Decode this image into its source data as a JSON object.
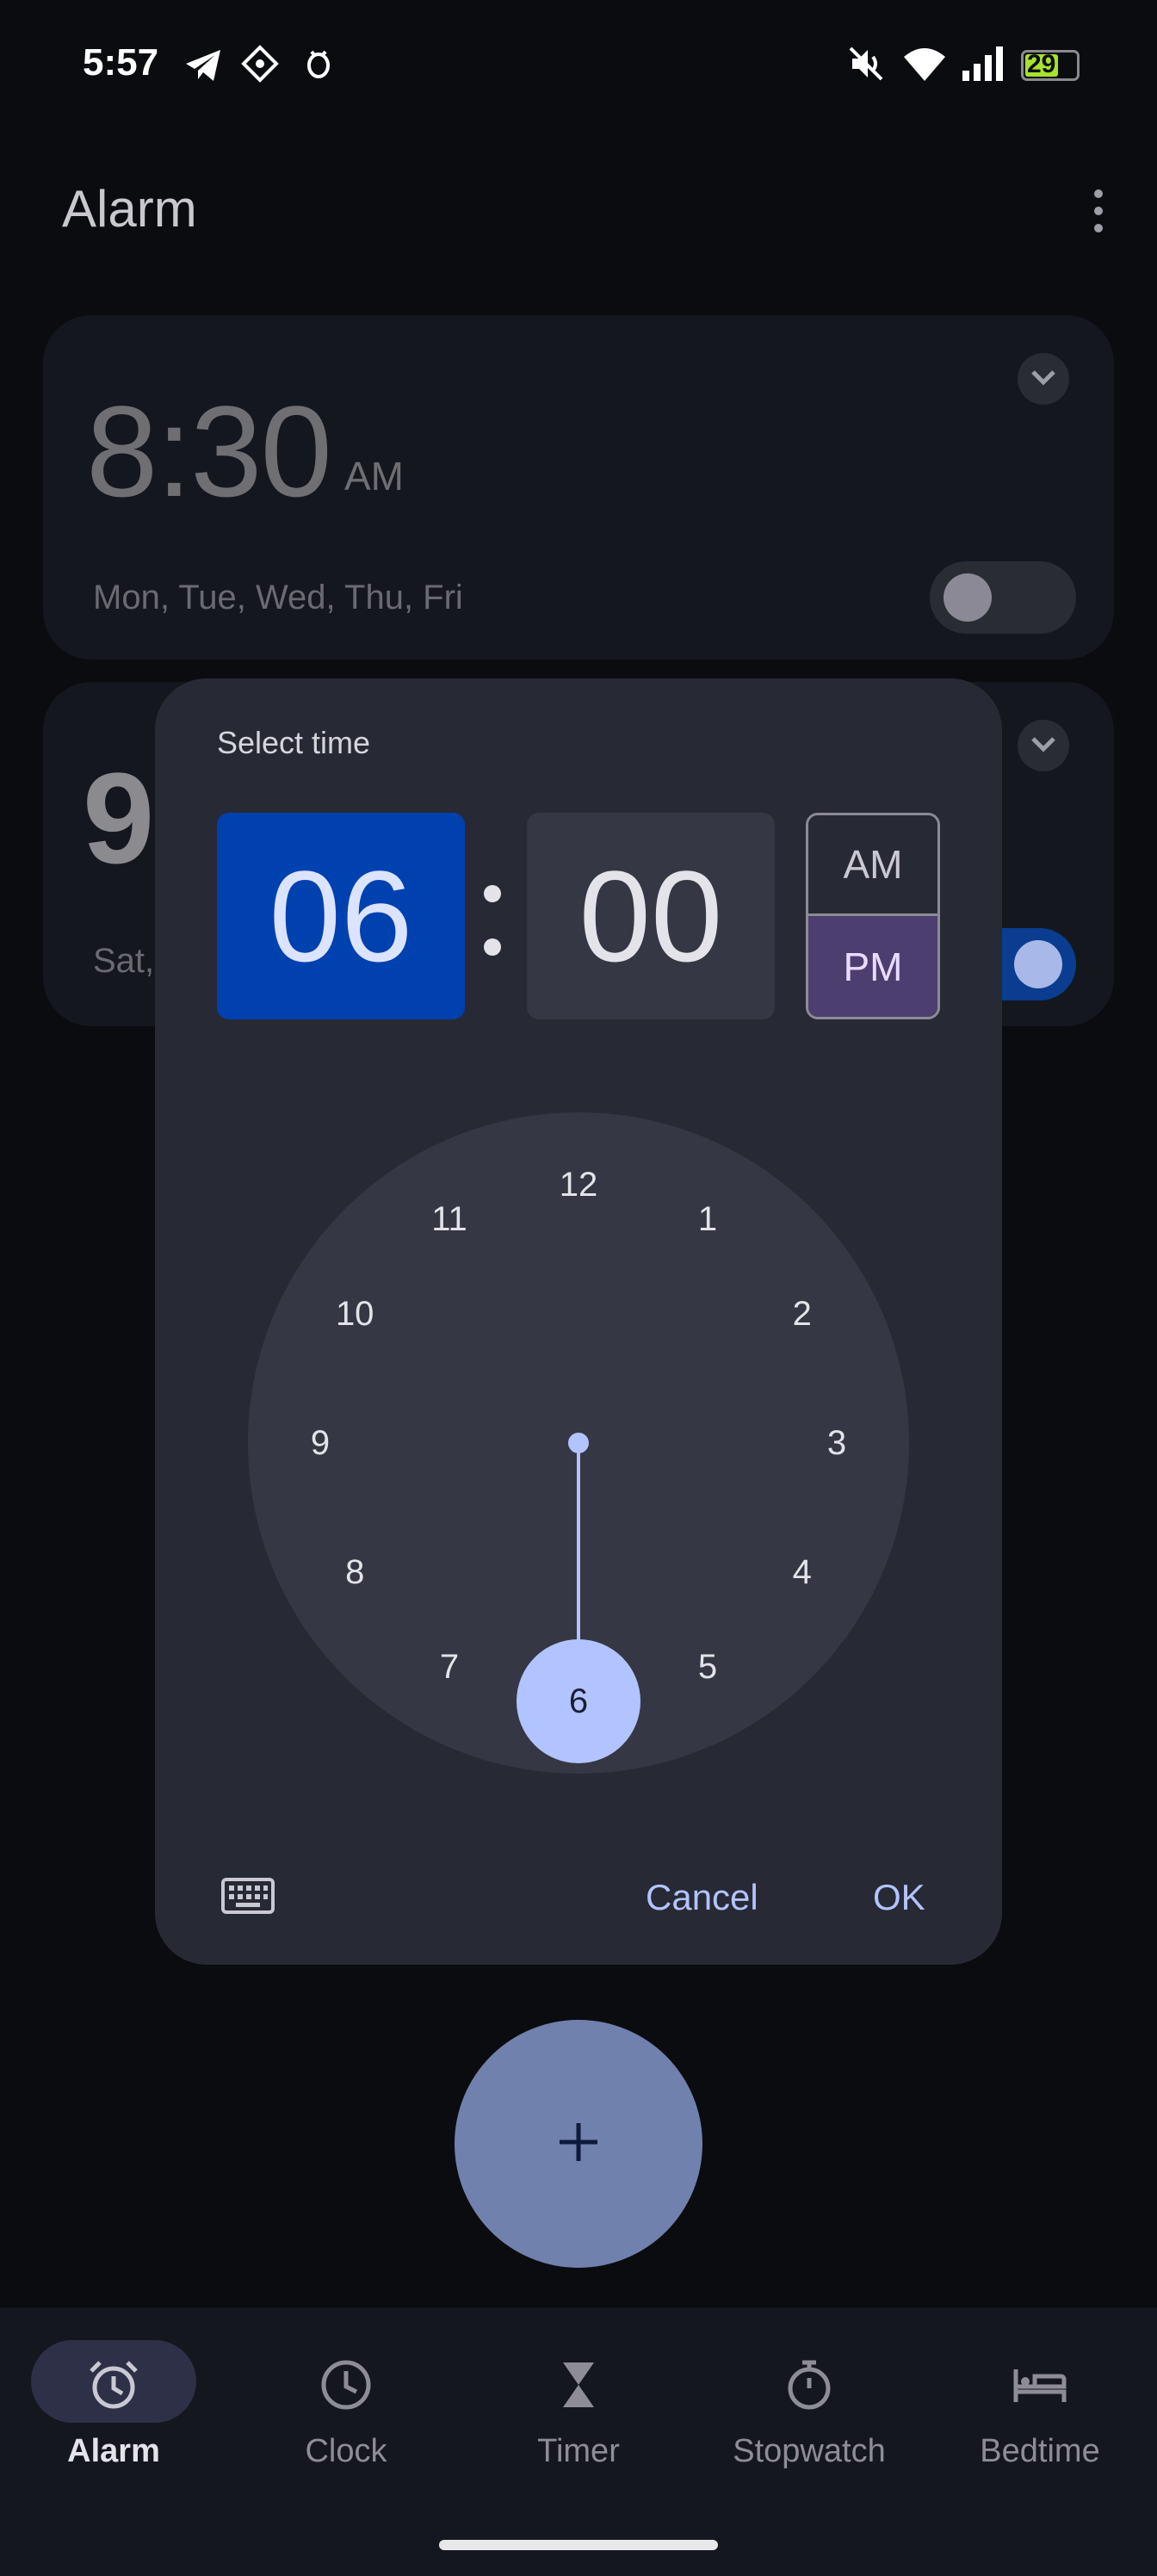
{
  "status_bar": {
    "time": "5:57",
    "battery": "29",
    "icons": [
      "telegram-icon",
      "diamond-app-icon",
      "bug-icon",
      "mute-icon",
      "wifi-icon",
      "signal-icon",
      "battery-charging-icon"
    ]
  },
  "app": {
    "title": "Alarm"
  },
  "alarms": [
    {
      "time": "8:30",
      "ampm": "AM",
      "days": "Mon, Tue, Wed, Thu, Fri",
      "enabled": false
    },
    {
      "time": "9",
      "days": "Sat,",
      "enabled": true
    }
  ],
  "dialog": {
    "title": "Select time",
    "hour": "06",
    "minute": "00",
    "am_label": "AM",
    "pm_label": "PM",
    "selected_period": "PM",
    "dial_numbers": [
      "12",
      "1",
      "2",
      "3",
      "4",
      "5",
      "6",
      "7",
      "8",
      "9",
      "10",
      "11"
    ],
    "selected_number": "6",
    "cancel_label": "Cancel",
    "ok_label": "OK"
  },
  "fab": {
    "icon": "plus-icon"
  },
  "nav": {
    "items": [
      {
        "label": "Alarm",
        "icon": "alarm-icon",
        "active": true
      },
      {
        "label": "Clock",
        "icon": "clock-icon",
        "active": false
      },
      {
        "label": "Timer",
        "icon": "hourglass-icon",
        "active": false
      },
      {
        "label": "Stopwatch",
        "icon": "stopwatch-icon",
        "active": false
      },
      {
        "label": "Bedtime",
        "icon": "bed-icon",
        "active": false
      }
    ]
  },
  "colors": {
    "background": "#0b0c10",
    "dialog": "#272a34",
    "hour_selected": "#0041b0",
    "pm_selected": "#4c3f70",
    "accent": "#b2c4ff",
    "fab": "#7081ad"
  }
}
